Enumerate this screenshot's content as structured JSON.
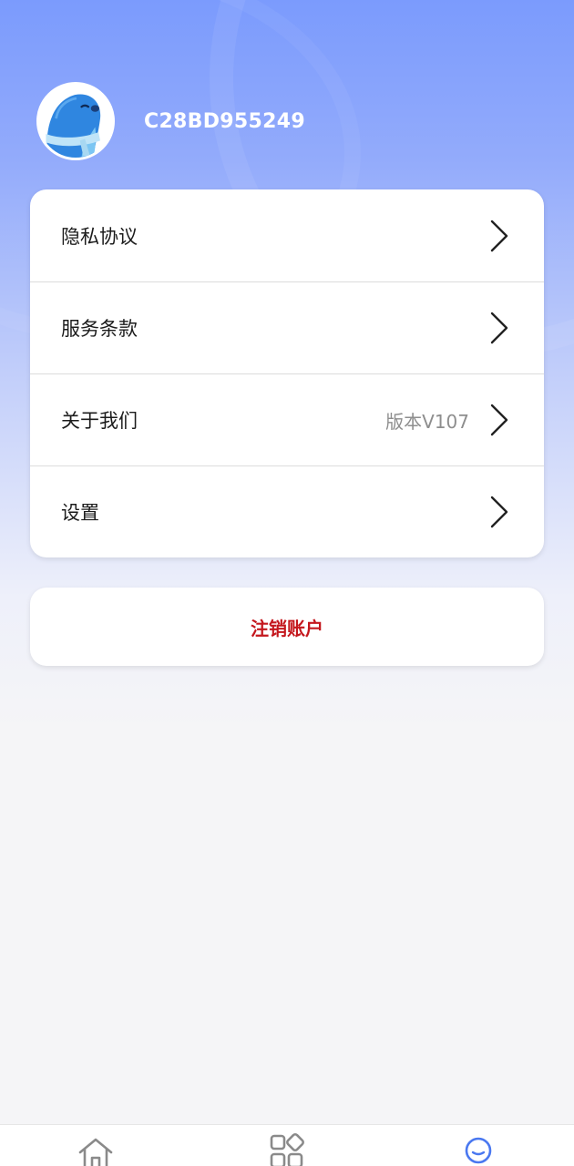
{
  "profile": {
    "user_id": "C28BD955249",
    "avatar_icon": "seal-mascot-avatar"
  },
  "menu": {
    "items": [
      {
        "label": "隐私协议",
        "extra": "",
        "icon": "chevron-right-icon"
      },
      {
        "label": "服务条款",
        "extra": "",
        "icon": "chevron-right-icon"
      },
      {
        "label": "关于我们",
        "extra": "版本V107",
        "icon": "chevron-right-icon"
      },
      {
        "label": "设置",
        "extra": "",
        "icon": "chevron-right-icon"
      }
    ]
  },
  "logout": {
    "label": "注销账户",
    "color": "#c4171d"
  },
  "bottom_nav": {
    "tabs": [
      {
        "icon": "home-icon",
        "active": false
      },
      {
        "icon": "apps-grid-icon",
        "active": false
      },
      {
        "icon": "profile-icon",
        "active": true
      }
    ],
    "active_color": "#4a78f0",
    "inactive_color": "#8a8a8a"
  },
  "colors": {
    "header_gradient_top": "#7b9bfd",
    "page_background": "#f5f5f7"
  }
}
